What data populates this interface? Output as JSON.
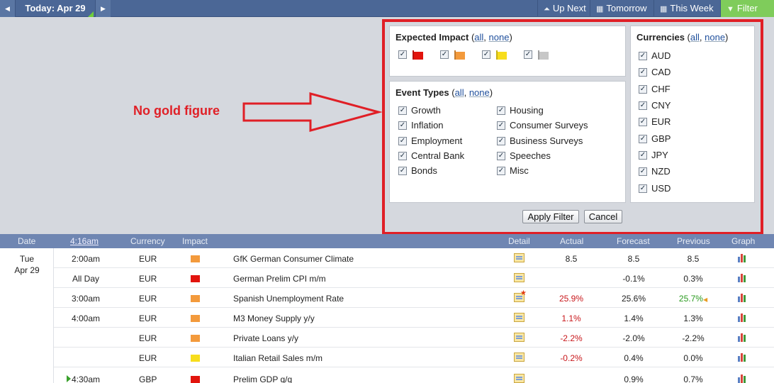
{
  "topbar": {
    "prev_icon": "triangle-left",
    "today_label": "Today: Apr 29",
    "next_icon": "triangle-right",
    "up_next": "Up Next",
    "tomorrow": "Tomorrow",
    "this_week": "This Week",
    "filter": "Filter",
    "filter_active_color": "#7fcc5b"
  },
  "filter": {
    "impact": {
      "title": "Expected Impact",
      "all": "all",
      "none": "none",
      "levels": [
        {
          "color": "red",
          "checked": true
        },
        {
          "color": "orange",
          "checked": true
        },
        {
          "color": "yellow",
          "checked": true
        },
        {
          "color": "grey",
          "checked": true
        }
      ]
    },
    "events": {
      "title": "Event Types",
      "all": "all",
      "none": "none",
      "items": [
        "Growth",
        "Inflation",
        "Employment",
        "Central Bank",
        "Bonds",
        "Housing",
        "Consumer Surveys",
        "Business Surveys",
        "Speeches",
        "Misc"
      ]
    },
    "currencies": {
      "title": "Currencies",
      "all": "all",
      "none": "none",
      "items": [
        "AUD",
        "CAD",
        "CHF",
        "CNY",
        "EUR",
        "GBP",
        "JPY",
        "NZD",
        "USD"
      ]
    },
    "apply": "Apply Filter",
    "cancel": "Cancel",
    "highlight_color": "#e01f26"
  },
  "annotation": "No gold figure",
  "table": {
    "headers": {
      "date": "Date",
      "time": "4:16am",
      "currency": "Currency",
      "impact": "Impact",
      "detail": "Detail",
      "actual": "Actual",
      "forecast": "Forecast",
      "previous": "Previous",
      "graph": "Graph"
    },
    "date_day": "Tue",
    "date_md": "Apr 29",
    "rows": [
      {
        "time": "2:00am",
        "currency": "EUR",
        "impact": "orange",
        "event": "GfK German Consumer Climate",
        "actual": "8.5",
        "forecast": "8.5",
        "previous": "8.5"
      },
      {
        "time": "All Day",
        "currency": "EUR",
        "impact": "red",
        "event": "German Prelim CPI m/m",
        "actual": "",
        "forecast": "-0.1%",
        "previous": "0.3%"
      },
      {
        "time": "3:00am",
        "currency": "EUR",
        "impact": "orange",
        "event": "Spanish Unemployment Rate",
        "actual": "25.9%",
        "forecast": "25.6%",
        "previous": "25.7%"
      },
      {
        "time": "4:00am",
        "currency": "EUR",
        "impact": "orange",
        "event": "M3 Money Supply y/y",
        "actual": "1.1%",
        "forecast": "1.4%",
        "previous": "1.3%"
      },
      {
        "time": "",
        "currency": "EUR",
        "impact": "orange",
        "event": "Private Loans y/y",
        "actual": "-2.2%",
        "forecast": "-2.0%",
        "previous": "-2.2%"
      },
      {
        "time": "",
        "currency": "EUR",
        "impact": "yellow",
        "event": "Italian Retail Sales m/m",
        "actual": "-0.2%",
        "forecast": "0.4%",
        "previous": "0.0%"
      },
      {
        "time": "4:30am",
        "currency": "GBP",
        "impact": "red",
        "event": "Prelim GDP q/q",
        "actual": "",
        "forecast": "0.9%",
        "previous": "0.7%"
      }
    ]
  }
}
